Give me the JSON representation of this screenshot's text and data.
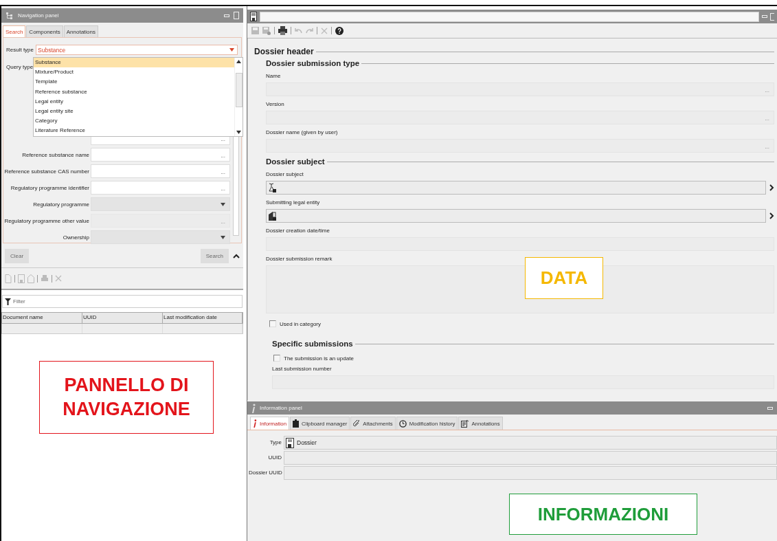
{
  "navigation_panel": {
    "title": "Navigation panel",
    "tabs": [
      {
        "label": "Search",
        "selected": true
      },
      {
        "label": "Components",
        "selected": false
      },
      {
        "label": "Annotations",
        "selected": false
      }
    ],
    "result_type": {
      "label": "Result type",
      "value": "Substance"
    },
    "query_type": {
      "label": "Query type"
    },
    "dropdown_options": [
      {
        "label": "Substance",
        "selected": true
      },
      {
        "label": "Mixture/Product",
        "selected": false
      },
      {
        "label": "Template",
        "selected": false
      },
      {
        "label": "Reference substance",
        "selected": false
      },
      {
        "label": "Legal entity",
        "selected": false
      },
      {
        "label": "Legal entity site",
        "selected": false
      },
      {
        "label": "Category",
        "selected": false
      },
      {
        "label": "Literature Reference",
        "selected": false
      }
    ],
    "fields": [
      {
        "kind": "text",
        "button": "..."
      },
      {
        "kind": "text",
        "label": "Reference substance name",
        "button": "..."
      },
      {
        "kind": "text",
        "label": "Reference substance CAS number",
        "button": "..."
      },
      {
        "kind": "text",
        "label": "Regulatory programme identifier",
        "button": "..."
      },
      {
        "kind": "select",
        "label": "Regulatory programme"
      },
      {
        "kind": "disabled",
        "label": "Regulatory programme other value",
        "button": "..."
      },
      {
        "kind": "select",
        "label": "Ownership"
      }
    ],
    "clear_button": "Clear",
    "search_button": "Search",
    "filter": {
      "placeholder": "Filter"
    },
    "table": {
      "columns": [
        "Document name",
        "UUID",
        "Last modification date"
      ]
    },
    "annotation": {
      "text": "PANNELLO DI NAVIGAZIONE",
      "color": "#e3141b"
    }
  },
  "dossier_panel": {
    "form": {
      "title": "Dossier header",
      "groups": [
        {
          "title": "Dossier submission type",
          "items": [
            {
              "kind": "text",
              "label": "Name",
              "button": "..."
            },
            {
              "kind": "text",
              "label": "Version",
              "button": "..."
            },
            {
              "kind": "text",
              "label": "Dossier name (given by user)",
              "button": "..."
            }
          ]
        },
        {
          "title": "Dossier subject",
          "items": [
            {
              "kind": "reference",
              "label": "Dossier subject"
            },
            {
              "kind": "reference",
              "label": "Submitting legal entity"
            },
            {
              "kind": "plain",
              "label": "Dossier creation date/time"
            },
            {
              "kind": "textarea",
              "label": "Dossier submission remark"
            },
            {
              "kind": "checkbox",
              "label": "Used in category",
              "checked": false
            }
          ],
          "subgroups": [
            {
              "title": "Specific submissions",
              "items": [
                {
                  "kind": "checkbox",
                  "label": "The submission is an update",
                  "checked": false
                },
                {
                  "kind": "plain",
                  "label": "Last submission number"
                }
              ]
            }
          ]
        }
      ]
    },
    "annotation": {
      "text": "DATA",
      "color": "#f5b800"
    }
  },
  "information_panel": {
    "title": "Information panel",
    "tabs": [
      {
        "label": "Information",
        "selected": true
      },
      {
        "label": "Clipboard manager",
        "selected": false
      },
      {
        "label": "Attachments",
        "selected": false
      },
      {
        "label": "Modification history",
        "selected": false
      },
      {
        "label": "Annotations",
        "selected": false
      }
    ],
    "fields": [
      {
        "label": "Type",
        "value": "Dossier"
      },
      {
        "label": "UUID"
      },
      {
        "label": "Dossier UUID"
      }
    ],
    "annotation": {
      "text": "INFORMAZIONI",
      "color": "#1f9d3a"
    }
  }
}
